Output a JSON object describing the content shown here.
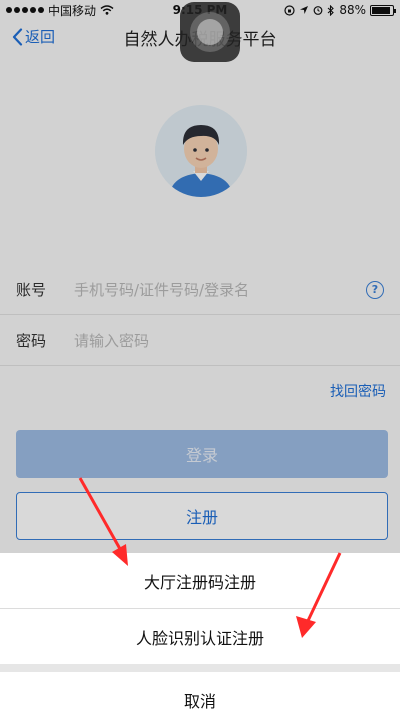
{
  "status_bar": {
    "carrier": "中国移动",
    "time": "9:15 PM",
    "battery": "88%",
    "battery_level": 0.88
  },
  "nav": {
    "back_label": "返回",
    "title": "自然人办税服务平台"
  },
  "form": {
    "account_label": "账号",
    "account_placeholder": "手机号码/证件号码/登录名",
    "password_label": "密码",
    "password_placeholder": "请输入密码",
    "forgot_label": "找回密码",
    "help_icon": "?"
  },
  "buttons": {
    "login_label": "登录",
    "register_label": "注册"
  },
  "action_sheet": {
    "options": [
      {
        "label": "大厅注册码注册"
      },
      {
        "label": "人脸识别认证注册"
      }
    ],
    "cancel_label": "取消"
  },
  "colors": {
    "accent": "#1f6fd6",
    "annotation_arrow": "#ff2a2a"
  }
}
